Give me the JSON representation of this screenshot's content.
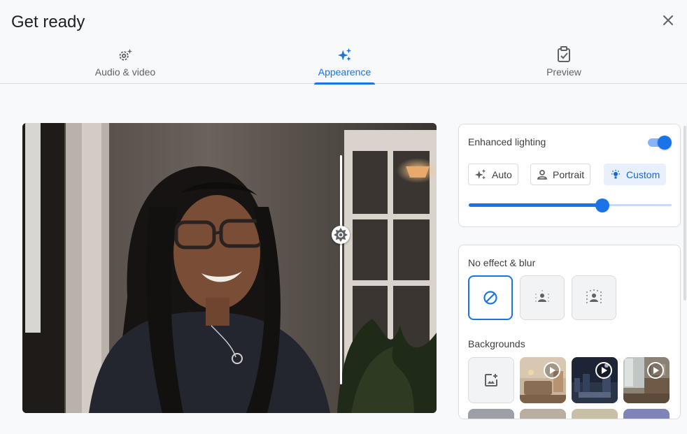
{
  "dialog": {
    "title": "Get ready"
  },
  "icons": {
    "close": "close-icon",
    "audio_video": "settings-sparkle-icon",
    "appearance": "sparkle-icon",
    "preview": "clipboard-check-icon",
    "brightness": "brightness-icon",
    "auto": "auto-awesome-icon",
    "portrait": "person-icon",
    "custom": "lightbulb-icon",
    "no_effect": "block-icon",
    "blur_slight": "blur-person-icon",
    "blur_full": "blur-person-icon",
    "add_background": "add-photo-icon",
    "animated": "play-circle-icon"
  },
  "tabs": [
    {
      "label": "Audio & video",
      "active": false
    },
    {
      "label": "Appearence",
      "active": true
    },
    {
      "label": "Preview",
      "active": false
    }
  ],
  "lighting": {
    "label": "Enhanced lighting",
    "enabled": true,
    "modes": [
      {
        "label": "Auto",
        "selected": false
      },
      {
        "label": "Portrait",
        "selected": false
      },
      {
        "label": "Custom",
        "selected": true
      }
    ],
    "level": 0.66
  },
  "video": {
    "brightness": 0.7
  },
  "effects": {
    "label": "No effect & blur",
    "options": [
      "no-effect",
      "slight-blur",
      "blur"
    ],
    "selected": "no-effect"
  },
  "backgrounds": {
    "label": "Backgrounds",
    "items": [
      "add-background",
      "living-room",
      "night-city",
      "cozy-room"
    ]
  },
  "colors": {
    "accent": "#1a73e8",
    "accent_light": "#e8f0fe",
    "border": "#dadce0"
  }
}
